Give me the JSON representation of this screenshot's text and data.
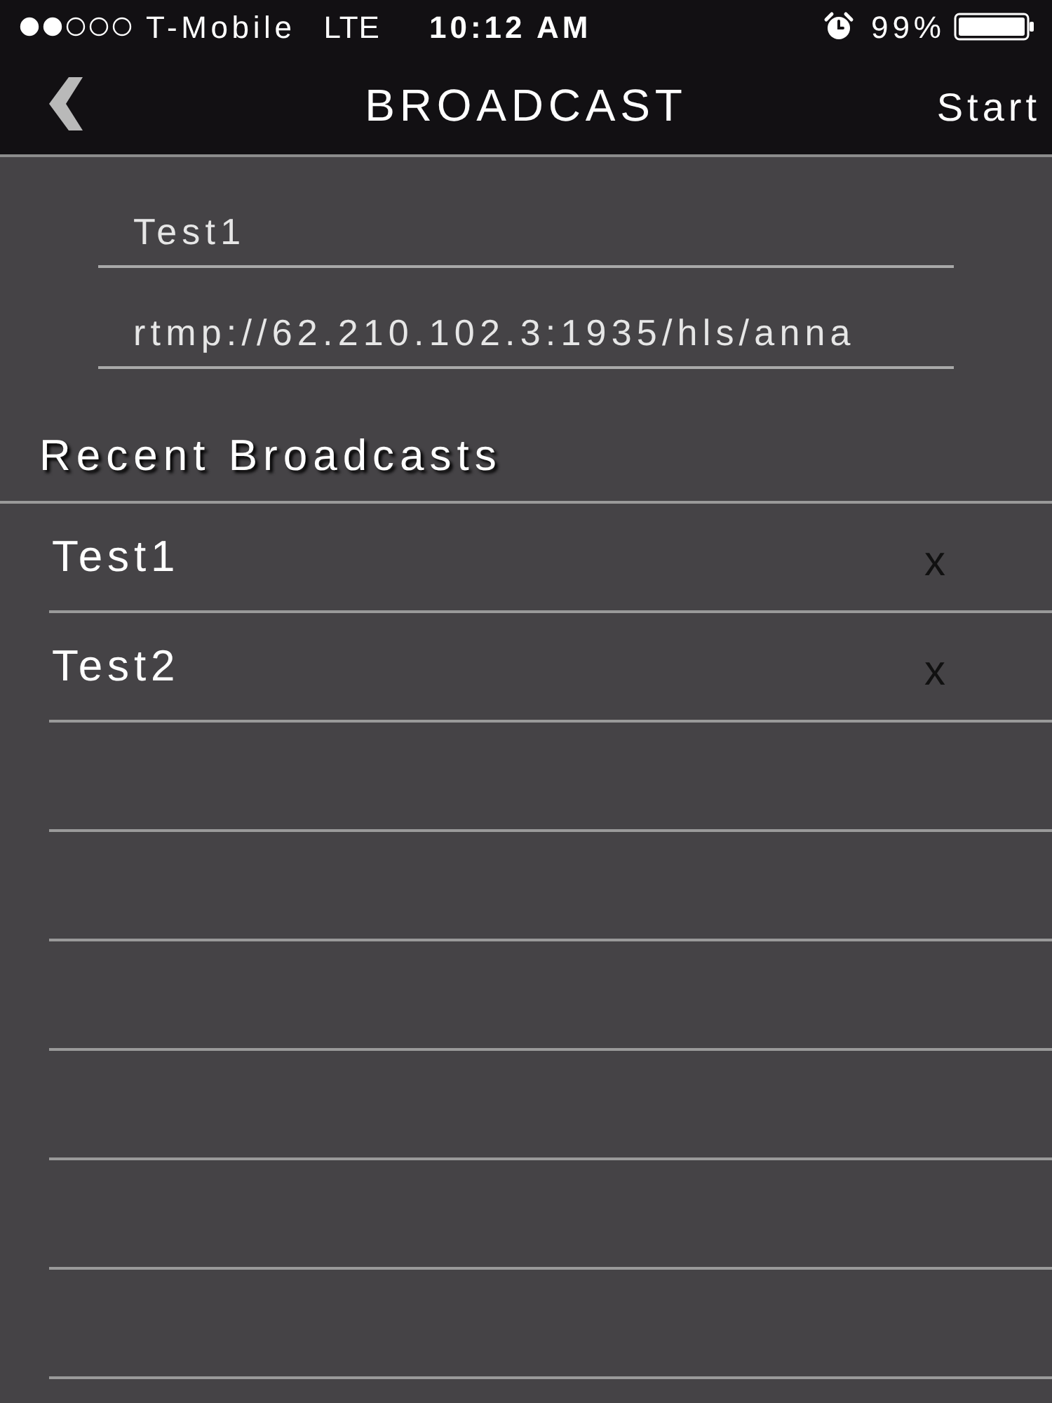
{
  "status_bar": {
    "carrier": "T-Mobile",
    "network": "LTE",
    "time": "10:12 AM",
    "battery_percent": "99%"
  },
  "nav_bar": {
    "title": "BROADCAST",
    "action": "Start"
  },
  "form": {
    "fields": [
      {
        "value": "Test1"
      },
      {
        "value": "rtmp://62.210.102.3:1935/hls/anna"
      }
    ]
  },
  "recent": {
    "heading": "Recent Broadcasts",
    "items": [
      {
        "name": "Test1",
        "delete": "x"
      },
      {
        "name": "Test2",
        "delete": "x"
      }
    ]
  }
}
